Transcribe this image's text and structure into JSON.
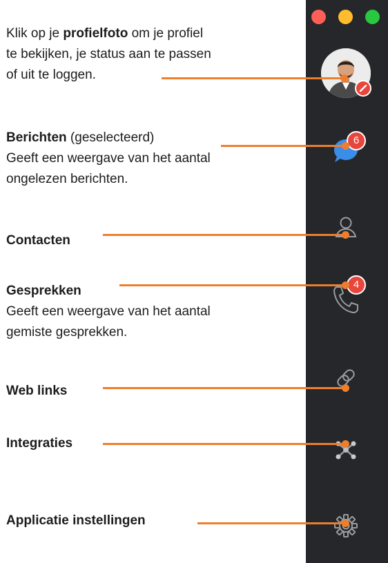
{
  "callouts": {
    "profile": {
      "line1_pre": "Klik op je ",
      "line1_bold": "profielfoto",
      "line1_post": " om je profiel",
      "line2": "te bekijken, je status aan te passen",
      "line3": "of uit te loggen."
    },
    "messages": {
      "title": "Berichten",
      "title_suffix": " (geselecteerd)",
      "line2": "Geeft een weergave van het aantal",
      "line3": "ongelezen berichten."
    },
    "contacts": {
      "title": "Contacten"
    },
    "calls": {
      "title": "Gesprekken",
      "line2": "Geeft een weergave van het aantal",
      "line3": "gemiste gesprekken."
    },
    "weblinks": {
      "title": "Web links"
    },
    "integrations": {
      "title": "Integraties"
    },
    "settings": {
      "title": "Applicatie instellingen"
    }
  },
  "sidebar": {
    "traffic_lights": [
      "#ff5f57",
      "#febc2e",
      "#28c840"
    ],
    "messages_badge": "6",
    "calls_badge": "4",
    "icons": [
      "avatar",
      "chat-bubble-icon",
      "contact-icon",
      "phone-icon",
      "link-icon",
      "integrations-icon",
      "gear-icon"
    ]
  },
  "colors": {
    "callout": "#ee7e2c",
    "sidebar_bg": "#25272a",
    "badge": "#e8453c",
    "chat_icon": "#3b8ee8",
    "icon_gray": "#9a9da1"
  }
}
